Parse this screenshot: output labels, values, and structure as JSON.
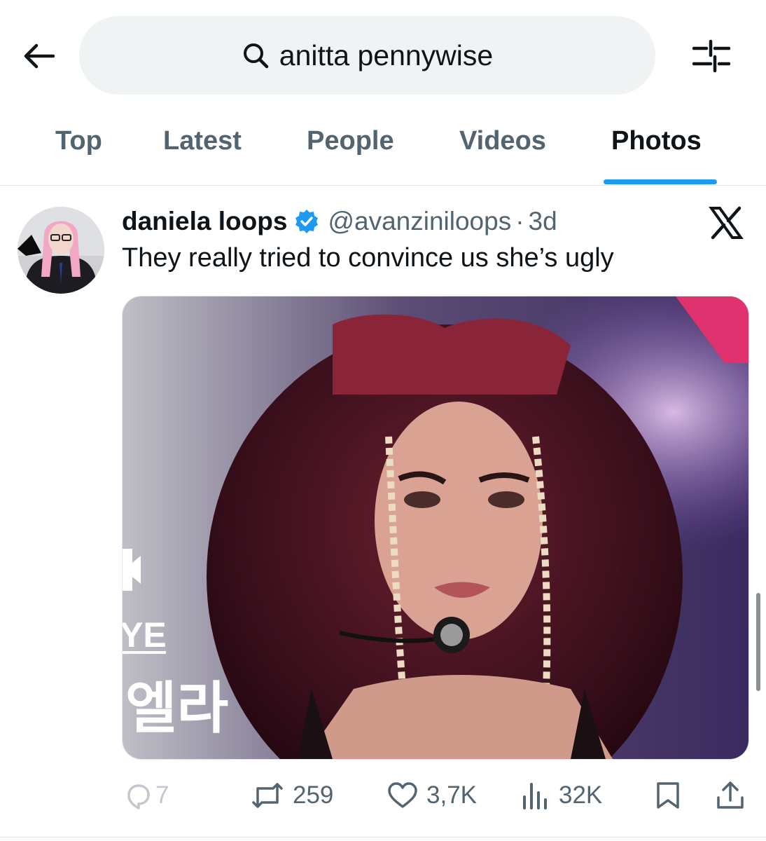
{
  "search": {
    "query": "anitta pennywise"
  },
  "tabs": [
    {
      "label": "Top"
    },
    {
      "label": "Latest"
    },
    {
      "label": "People"
    },
    {
      "label": "Videos"
    },
    {
      "label": "Photos",
      "active": true
    }
  ],
  "tweet": {
    "display_name": "daniela loops",
    "handle": "@avanziniloops",
    "separator": "·",
    "time": "3d",
    "text": "They really tried to convince us she’s ugly",
    "media": {
      "overlay_text_en": "YE",
      "overlay_text_kr": "엘라"
    },
    "stats": {
      "replies": "7",
      "reposts": "259",
      "likes": "3,7K",
      "views": "32K"
    }
  },
  "colors": {
    "accent": "#1d9bf0",
    "text_primary": "#0f1419",
    "text_secondary": "#536471",
    "search_bg": "#eff3f4"
  },
  "icons": [
    "back-arrow-icon",
    "search-icon",
    "filter-sliders-icon",
    "verified-badge-icon",
    "x-logo-icon",
    "reply-icon",
    "repost-icon",
    "like-icon",
    "views-icon",
    "bookmark-icon",
    "share-icon"
  ]
}
